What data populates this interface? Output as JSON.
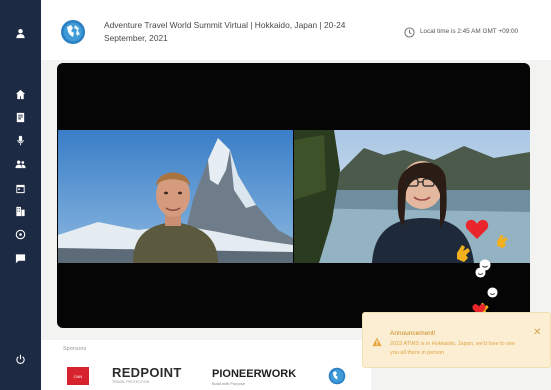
{
  "sidebar": {
    "items": [
      {
        "name": "user-icon"
      },
      {
        "name": "home-icon"
      },
      {
        "name": "document-icon"
      },
      {
        "name": "microphone-icon"
      },
      {
        "name": "people-icon"
      },
      {
        "name": "calendar-icon"
      },
      {
        "name": "building-icon"
      },
      {
        "name": "help-icon"
      },
      {
        "name": "chat-icon"
      },
      {
        "name": "power-icon"
      }
    ],
    "background": "#1d2a44"
  },
  "header": {
    "title": "Adventure Travel World Summit Virtual | Hokkaido, Japan | 20-24 September, 2021",
    "local_time": "Local time is 2:45 AM GMT +09:00"
  },
  "sponsors": {
    "label": "Sponsors",
    "red_logo_text": "CNN",
    "redpoint": "REDPOINT",
    "redpoint_sub": "TRAVEL PROTECTION",
    "pioneerwork": "PIONEERWORK",
    "pioneerwork_sub": "Build with Purpose"
  },
  "toast": {
    "title": "Announcement!",
    "message": "2023 ATWS is in Hokkaido, Japan, we'd love to see you all there in person",
    "accent": "#e0a545"
  }
}
